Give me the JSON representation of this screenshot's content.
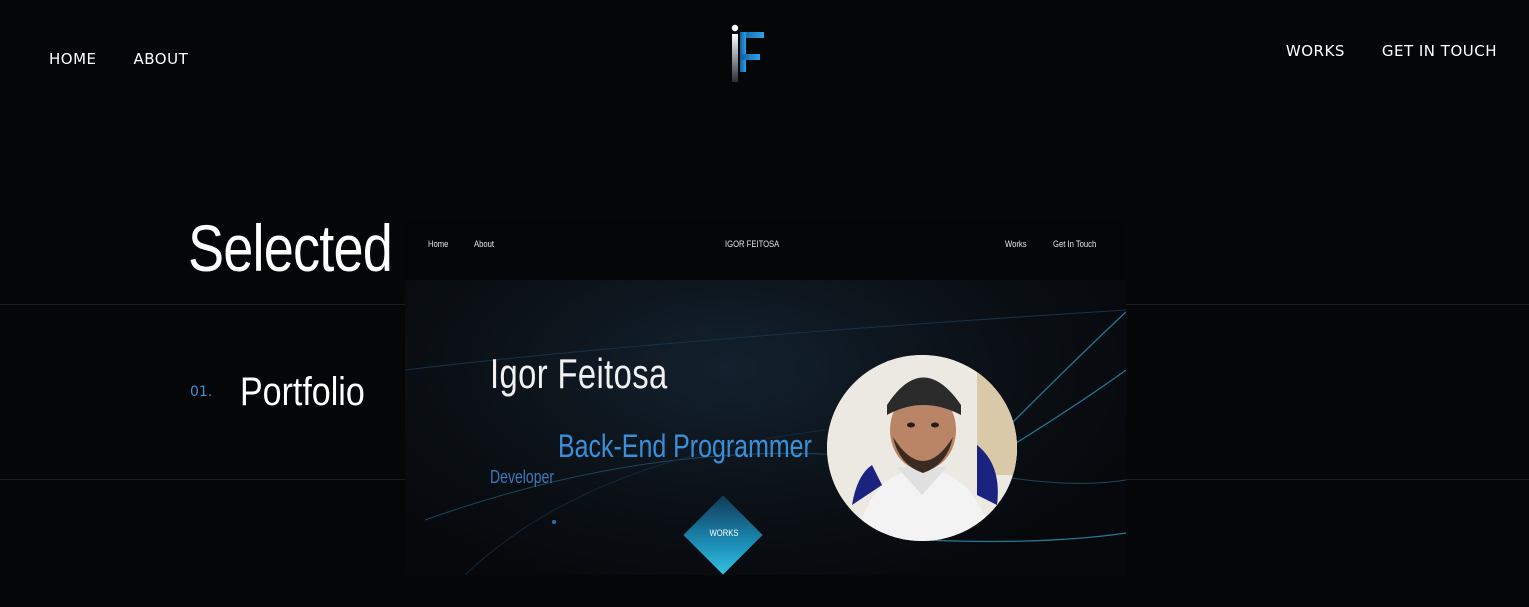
{
  "nav": {
    "home": "HOME",
    "about": "ABOUT",
    "works": "WORKS",
    "contact": "GET IN TOUCH"
  },
  "logo": {
    "icon": "if-monogram-logo",
    "accent": "#1e88e5"
  },
  "section": {
    "title": "Selected"
  },
  "works": [
    {
      "number": "01.",
      "title": "Portfolio"
    }
  ],
  "preview": {
    "nav": {
      "home": "Home",
      "about": "About",
      "brand": "IGOR FEITOSA",
      "works": "Works",
      "contact": "Get In Touch"
    },
    "name": "Igor Feitosa",
    "role": "Back-End Programmer",
    "subtitle": "Developer",
    "button": "WORKS",
    "photo_icon": "profile-photo"
  },
  "colors": {
    "background": "#050608",
    "accent": "#3d8fd6",
    "text": "#ffffff"
  }
}
